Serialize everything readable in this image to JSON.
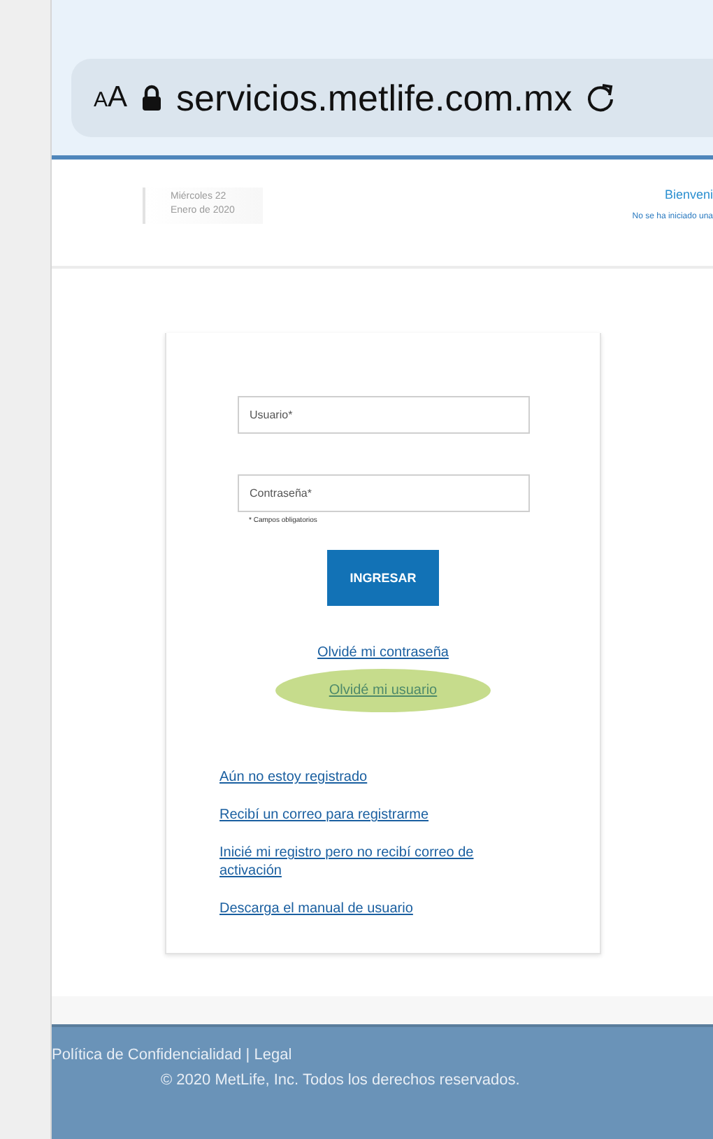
{
  "browser_bar": {
    "text_size_label": "AA",
    "url": "servicios.metlife.com.mx"
  },
  "header": {
    "date_lines": [
      "Miércoles 22",
      "Enero de 2020"
    ],
    "welcome": "Bienveni",
    "session_status": "No se ha iniciado una"
  },
  "login": {
    "fields": [
      {
        "placeholder": "Usuario*"
      },
      {
        "placeholder": "Contraseña*"
      }
    ],
    "required_note": "* Campos obligatorios",
    "submit": "INGRESAR",
    "recovery_links": [
      {
        "label": "Olvidé mi contraseña",
        "highlighted": false
      },
      {
        "label": "Olvidé mi usuario",
        "highlighted": true
      }
    ],
    "help_links": [
      "Aún no estoy registrado",
      "Recibí un correo para registrarme",
      "Inicié mi registro pero no recibí correo de activación",
      "Descarga el manual de usuario"
    ]
  },
  "footer": {
    "links": "Política de Confidencialidad | Legal",
    "copyright": "© 2020 MetLife, Inc. Todos los derechos reservados."
  }
}
